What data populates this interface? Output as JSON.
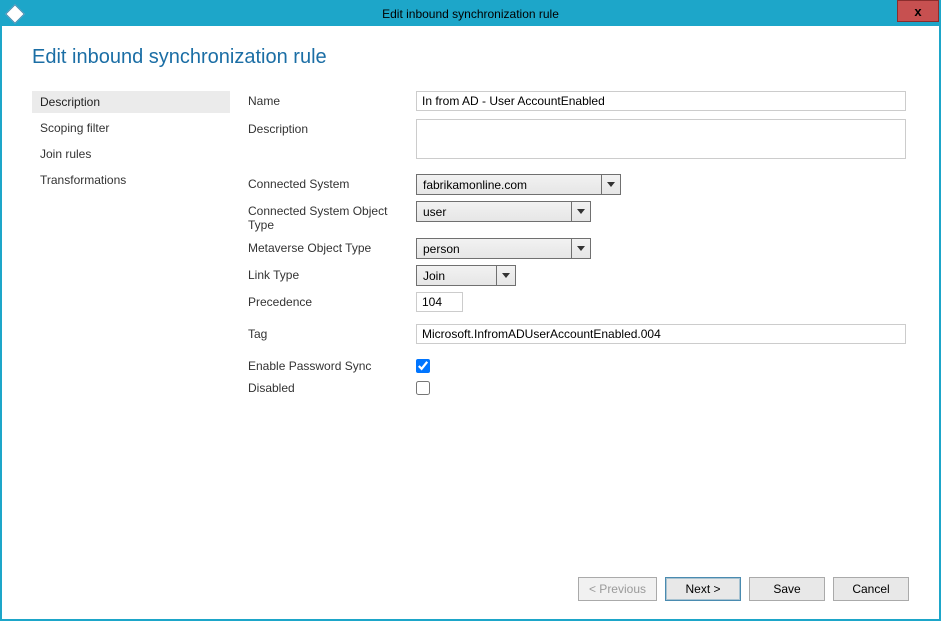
{
  "window": {
    "title": "Edit inbound synchronization rule",
    "close": "x"
  },
  "heading": "Edit inbound synchronization rule",
  "sidebar": {
    "items": [
      {
        "label": "Description",
        "selected": true
      },
      {
        "label": "Scoping filter",
        "selected": false
      },
      {
        "label": "Join rules",
        "selected": false
      },
      {
        "label": "Transformations",
        "selected": false
      }
    ]
  },
  "form": {
    "name_label": "Name",
    "name_value": "In from AD - User AccountEnabled",
    "description_label": "Description",
    "description_value": "",
    "connected_system_label": "Connected System",
    "connected_system_value": "fabrikamonline.com",
    "cs_object_type_label": "Connected System Object Type",
    "cs_object_type_value": "user",
    "mv_object_type_label": "Metaverse Object Type",
    "mv_object_type_value": "person",
    "link_type_label": "Link Type",
    "link_type_value": "Join",
    "precedence_label": "Precedence",
    "precedence_value": "104",
    "tag_label": "Tag",
    "tag_value": "Microsoft.InfromADUserAccountEnabled.004",
    "enable_pwd_sync_label": "Enable Password Sync",
    "enable_pwd_sync_value": true,
    "disabled_label": "Disabled",
    "disabled_value": false
  },
  "footer": {
    "previous": "< Previous",
    "next": "Next >",
    "save": "Save",
    "cancel": "Cancel"
  }
}
